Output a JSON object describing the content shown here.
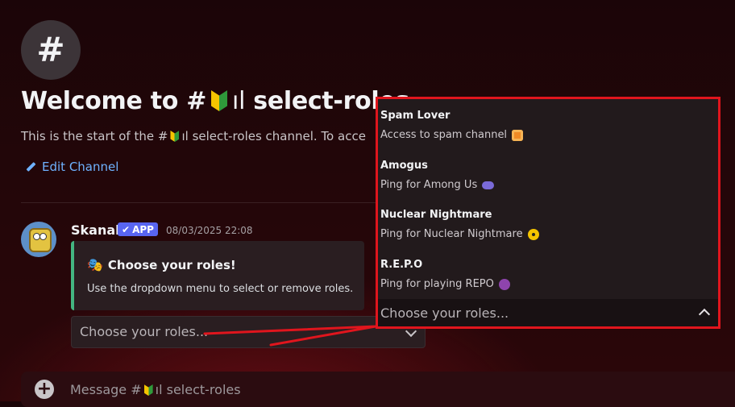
{
  "channel": {
    "hash_symbol": "#",
    "welcome_prefix": "Welcome to #",
    "welcome_suffix": "select-roles",
    "bars": "ıl",
    "desc_prefix": "This is the start of the #",
    "desc_suffix": "select-roles channel. To acce",
    "edit_label": "Edit Channel"
  },
  "message": {
    "author": "Skanak",
    "badge": "APP",
    "timestamp": "08/03/2025 22:08",
    "embed_title": "Choose your roles!",
    "embed_title_emoji": "🎭",
    "embed_description": "Use the dropdown menu to select or remove roles.",
    "select_placeholder": "Choose your roles..."
  },
  "dropdown": {
    "options": [
      {
        "label": "Spam Lover",
        "description": "Access to spam channel",
        "icon": "spam-icon"
      },
      {
        "label": "Amogus",
        "description": "Ping for Among Us",
        "icon": "gamepad-icon"
      },
      {
        "label": "Nuclear Nightmare",
        "description": "Ping for Nuclear Nightmare",
        "icon": "radioactive-icon"
      },
      {
        "label": "R.E.P.O",
        "description": "Ping for playing REPO",
        "icon": "devil-icon"
      }
    ],
    "placeholder": "Choose your roles..."
  },
  "composer": {
    "placeholder_prefix": "Message #",
    "placeholder_suffix": "select-roles"
  },
  "colors": {
    "accent_link": "#6fb2ff",
    "annotation_red": "#e0151d",
    "app_badge": "#5865f2",
    "embed_bar": "#43b581"
  }
}
